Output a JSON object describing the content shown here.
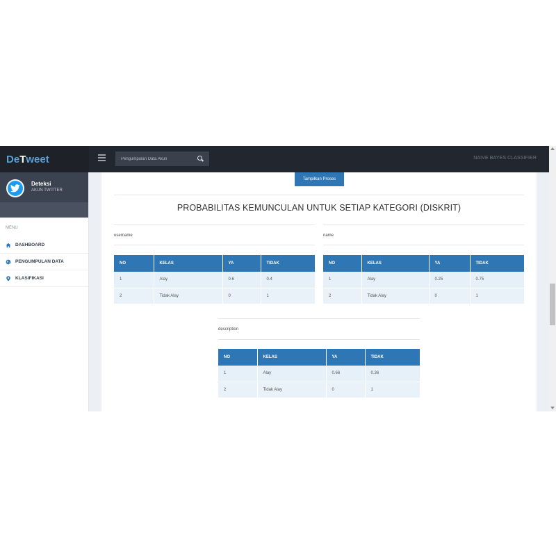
{
  "brand": {
    "part1": "De",
    "part2": "T",
    "part3": "weet"
  },
  "search": {
    "placeholder": "Pengumpulan Data Akun"
  },
  "navbar": {
    "right_text": "NAIVE BAYES CLASSIFIER"
  },
  "user": {
    "name": "Deteksi",
    "subtitle": "AKUN TWITTER"
  },
  "sidebar": {
    "menu_header": "MENU",
    "items": [
      {
        "label": "DASHBOARD",
        "icon": "home-icon"
      },
      {
        "label": "PENGUMPULAN DATA",
        "icon": "globe-icon"
      },
      {
        "label": "KLASIFIKASI",
        "icon": "map-marker-icon"
      }
    ]
  },
  "content": {
    "button_label": "Tampilkan Proses",
    "title": "PROBABILITAS KEMUNCULAN UNTUK SETIAP KATEGORI (DISKRIT)",
    "headers": [
      "NO",
      "KELAS",
      "YA",
      "TIDAK"
    ],
    "tables": [
      {
        "label": "username",
        "rows": [
          [
            "1",
            "Alay",
            "0.6",
            "0.4"
          ],
          [
            "2",
            "Tidak Alay",
            "0",
            "1"
          ]
        ]
      },
      {
        "label": "name",
        "rows": [
          [
            "1",
            "Alay",
            "0.25",
            "0.75"
          ],
          [
            "2",
            "Tidak Alay",
            "0",
            "1"
          ]
        ]
      },
      {
        "label": "description",
        "rows": [
          [
            "1",
            "Alay",
            "0.66",
            "0.36"
          ],
          [
            "2",
            "Tidak Alay",
            "0",
            "1"
          ]
        ]
      }
    ]
  },
  "colors": {
    "primary": "#2f76b5",
    "navbar": "#22262e",
    "sidebar_user": "#3c4350",
    "brand_accent": "#5aa0d6"
  }
}
